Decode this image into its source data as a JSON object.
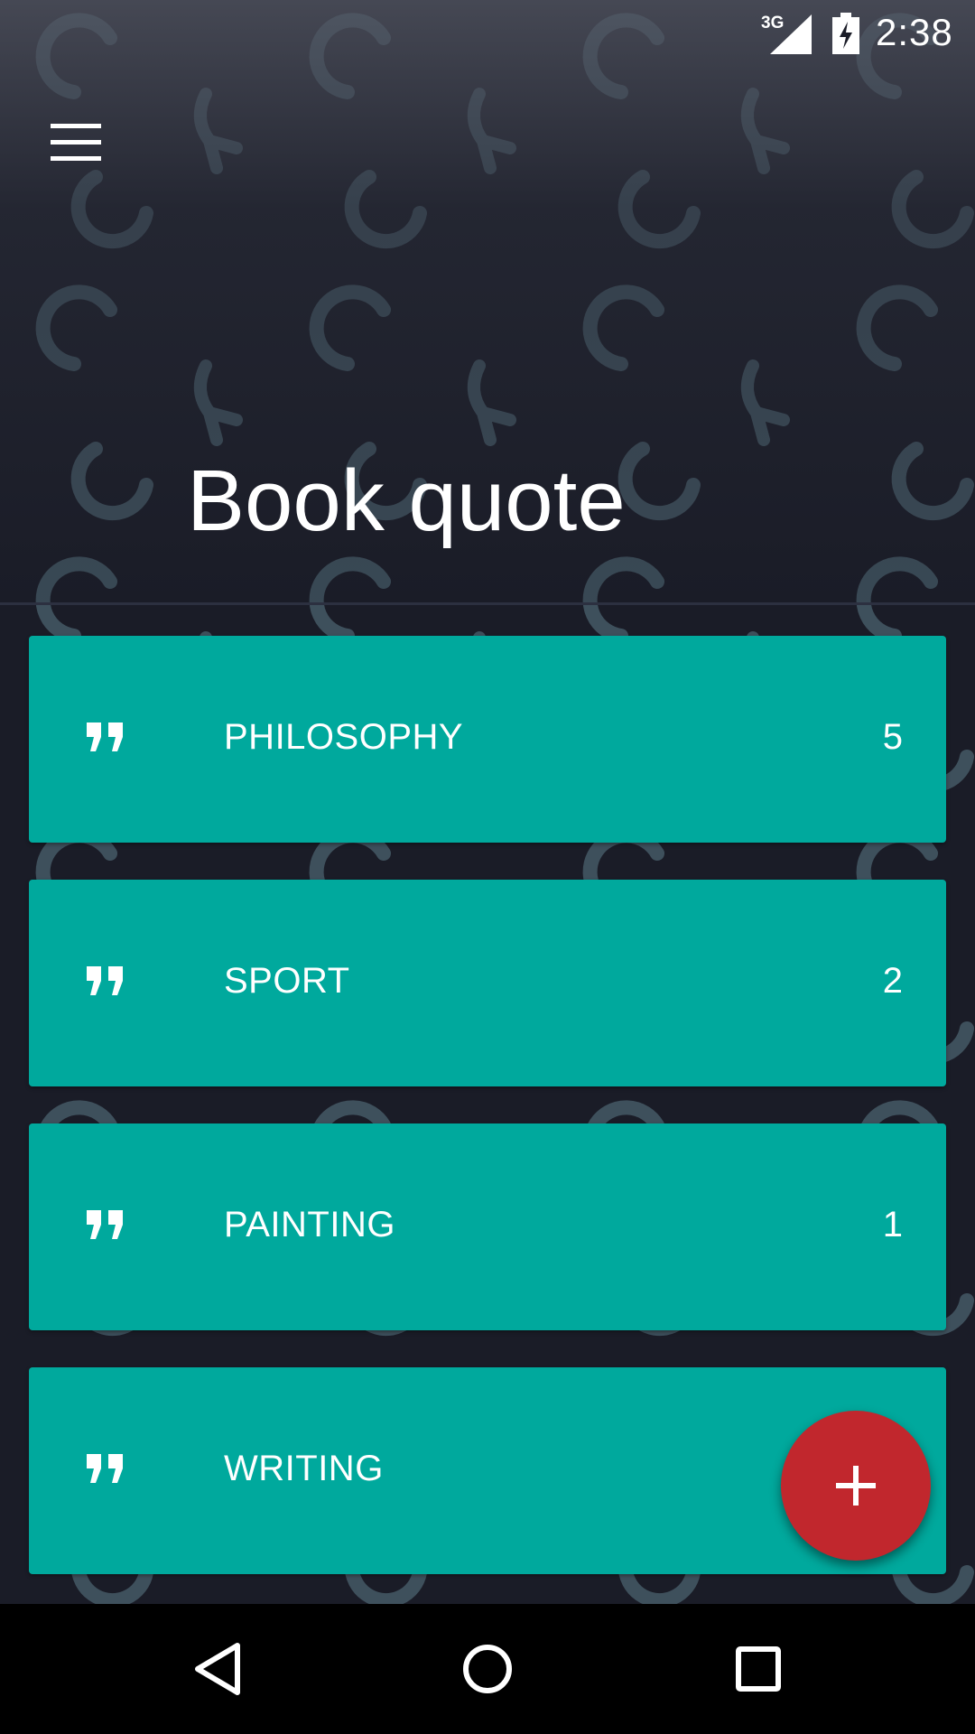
{
  "status_bar": {
    "network": "3G",
    "time": "2:38"
  },
  "header": {
    "title": "Book quote"
  },
  "categories": [
    {
      "label": "PHILOSOPHY",
      "count": "5"
    },
    {
      "label": "SPORT",
      "count": "2"
    },
    {
      "label": "PAINTING",
      "count": "1"
    },
    {
      "label": "WRITING",
      "count": ""
    }
  ],
  "icons": {
    "menu": "menu-icon",
    "category": "quote-icon",
    "fab": "plus-icon",
    "nav_back": "back-icon",
    "nav_home": "home-icon",
    "nav_recents": "recents-icon"
  },
  "colors": {
    "background": "#1a1c27",
    "card": "#00a99d",
    "fab": "#c1272d",
    "pattern": "#3e505c"
  }
}
